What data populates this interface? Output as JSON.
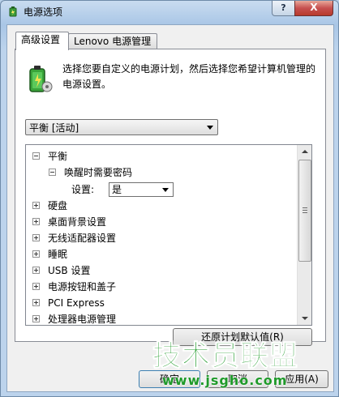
{
  "window": {
    "title": "电源选项",
    "help_label": "?",
    "close_label": "X"
  },
  "tabs": [
    {
      "label": "高级设置",
      "active": true
    },
    {
      "label": "Lenovo 电源管理",
      "active": false
    }
  ],
  "intro": {
    "text": "选择您要自定义的电源计划，然后选择您希望计算机管理的电源设置。"
  },
  "plan_select": {
    "value": "平衡 [活动]"
  },
  "tree": {
    "root": {
      "label": "平衡",
      "expanded": true
    },
    "password_node": {
      "label": "唤醒时需要密码",
      "expanded": true
    },
    "setting": {
      "label": "设置:",
      "value": "是"
    },
    "items": [
      {
        "label": "硬盘"
      },
      {
        "label": "桌面背景设置"
      },
      {
        "label": "无线适配器设置"
      },
      {
        "label": "睡眠"
      },
      {
        "label": "USB 设置"
      },
      {
        "label": "电源按钮和盖子"
      },
      {
        "label": "PCI Express"
      },
      {
        "label": "处理器电源管理"
      }
    ]
  },
  "buttons": {
    "restore_defaults": "还原计划默认值(R)",
    "ok": "确定",
    "cancel": "取消",
    "apply": "应用(A)"
  },
  "watermark": {
    "title": "技术员联盟",
    "url": "www.jsgho.com"
  },
  "colors": {
    "title_bar": "#a9c6e6",
    "close_button": "#c75050",
    "watermark_green": "#1f9a2a"
  }
}
